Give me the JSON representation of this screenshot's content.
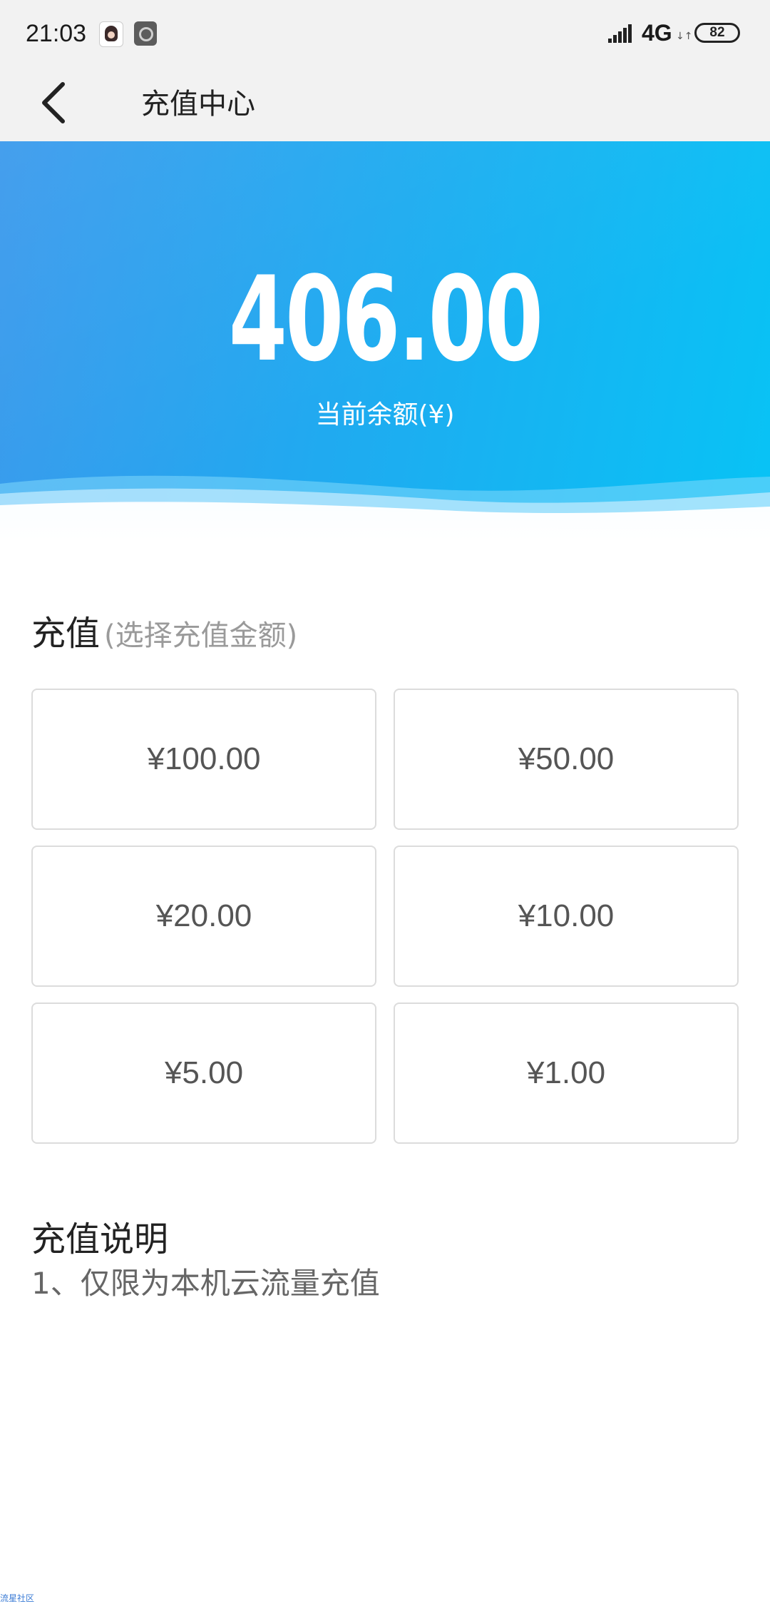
{
  "status_bar": {
    "time": "21:03",
    "network": "4G",
    "network_arrows": "↓↑",
    "battery": "82"
  },
  "header": {
    "title": "充值中心",
    "back_icon": "chevron-left-icon"
  },
  "balance": {
    "amount": "406.00",
    "label": "当前余额(¥)"
  },
  "recharge": {
    "title": "充值",
    "hint": "(选择充值金额)",
    "options": [
      "¥100.00",
      "¥50.00",
      "¥20.00",
      "¥10.00",
      "¥5.00",
      "¥1.00"
    ]
  },
  "notes": {
    "title": "充值说明",
    "lines": [
      "1、仅限为本机云流量充值"
    ]
  },
  "watermark": "流星社区",
  "colors": {
    "hero_start": "#3a99ec",
    "hero_end": "#08c3f5",
    "text_primary": "#222222",
    "text_secondary": "#9a9a9a",
    "option_border": "#dcdcdc",
    "option_text": "#555555"
  }
}
